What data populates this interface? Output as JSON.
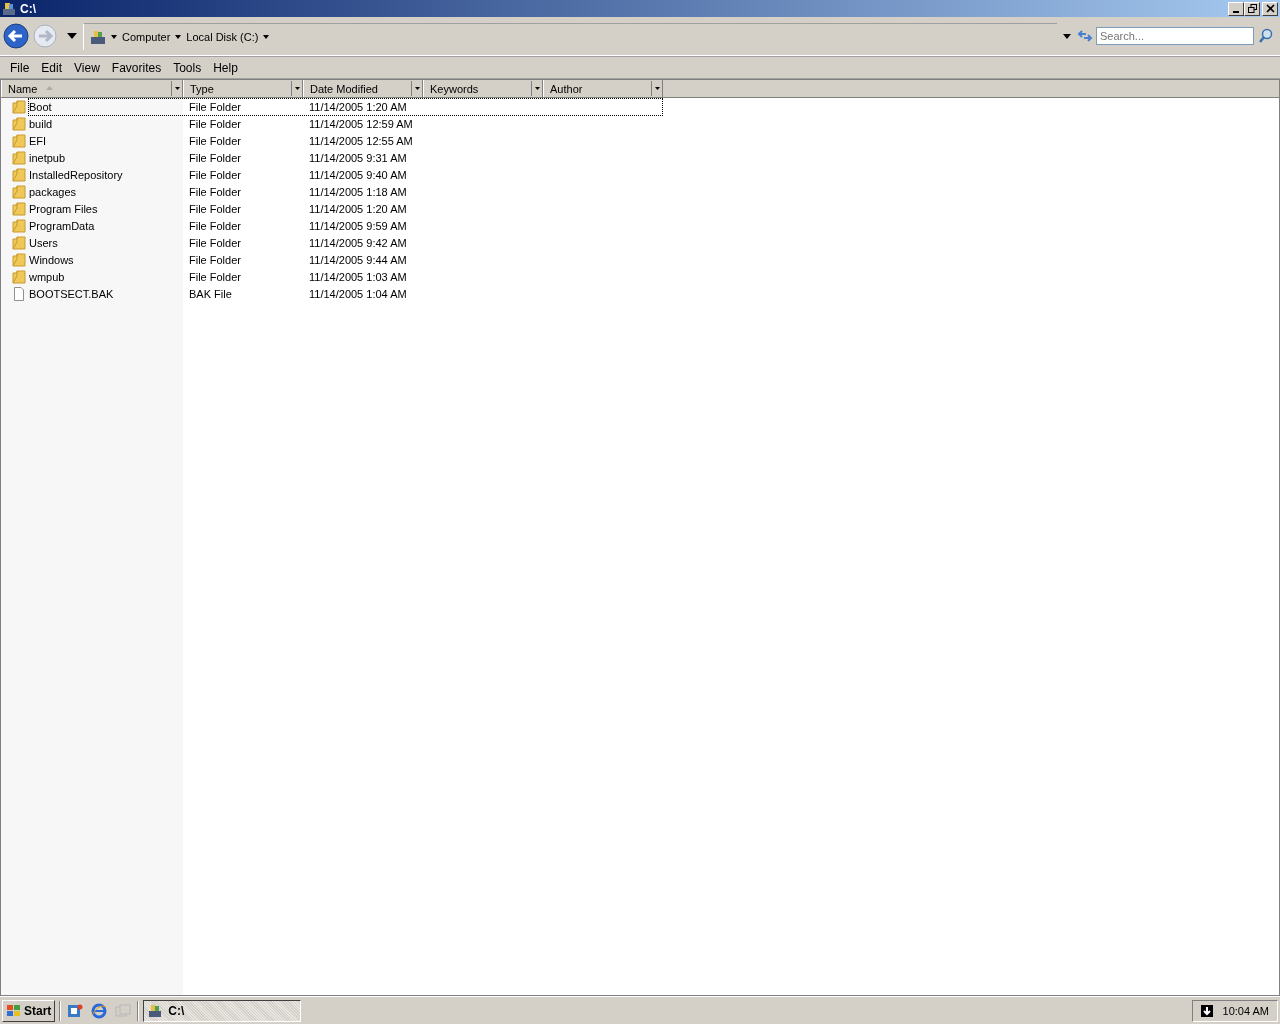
{
  "window": {
    "title": "C:\\"
  },
  "address_bar": {
    "breadcrumbs": [
      "Computer",
      "Local Disk (C:)"
    ]
  },
  "search": {
    "placeholder": "Search..."
  },
  "menu": [
    "File",
    "Edit",
    "View",
    "Favorites",
    "Tools",
    "Help"
  ],
  "table": {
    "columns": [
      {
        "label": "Name",
        "sorted": true
      },
      {
        "label": "Type",
        "sorted": false
      },
      {
        "label": "Date Modified",
        "sorted": false
      },
      {
        "label": "Keywords",
        "sorted": false
      },
      {
        "label": "Author",
        "sorted": false
      }
    ],
    "rows": [
      {
        "kind": "folder",
        "name": "Boot",
        "type": "File Folder",
        "date": "11/14/2005 1:20 AM",
        "focused": true
      },
      {
        "kind": "folder",
        "name": "build",
        "type": "File Folder",
        "date": "11/14/2005 12:59 AM",
        "focused": false
      },
      {
        "kind": "folder",
        "name": "EFI",
        "type": "File Folder",
        "date": "11/14/2005 12:55 AM",
        "focused": false
      },
      {
        "kind": "folder",
        "name": "inetpub",
        "type": "File Folder",
        "date": "11/14/2005 9:31 AM",
        "focused": false
      },
      {
        "kind": "folder",
        "name": "InstalledRepository",
        "type": "File Folder",
        "date": "11/14/2005 9:40 AM",
        "focused": false
      },
      {
        "kind": "folder",
        "name": "packages",
        "type": "File Folder",
        "date": "11/14/2005 1:18 AM",
        "focused": false
      },
      {
        "kind": "folder",
        "name": "Program Files",
        "type": "File Folder",
        "date": "11/14/2005 1:20 AM",
        "focused": false
      },
      {
        "kind": "folder",
        "name": "ProgramData",
        "type": "File Folder",
        "date": "11/14/2005 9:59 AM",
        "focused": false
      },
      {
        "kind": "folder",
        "name": "Users",
        "type": "File Folder",
        "date": "11/14/2005 9:42 AM",
        "focused": false
      },
      {
        "kind": "folder",
        "name": "Windows",
        "type": "File Folder",
        "date": "11/14/2005 9:44 AM",
        "focused": false
      },
      {
        "kind": "folder",
        "name": "wmpub",
        "type": "File Folder",
        "date": "11/14/2005 1:03 AM",
        "focused": false
      },
      {
        "kind": "file",
        "name": "BOOTSECT.BAK",
        "type": "BAK File",
        "date": "11/14/2005 1:04 AM",
        "focused": false
      }
    ]
  },
  "taskbar": {
    "start": "Start",
    "tasks": [
      {
        "label": "C:\\",
        "selected": true
      }
    ],
    "clock": "10:04 AM"
  }
}
